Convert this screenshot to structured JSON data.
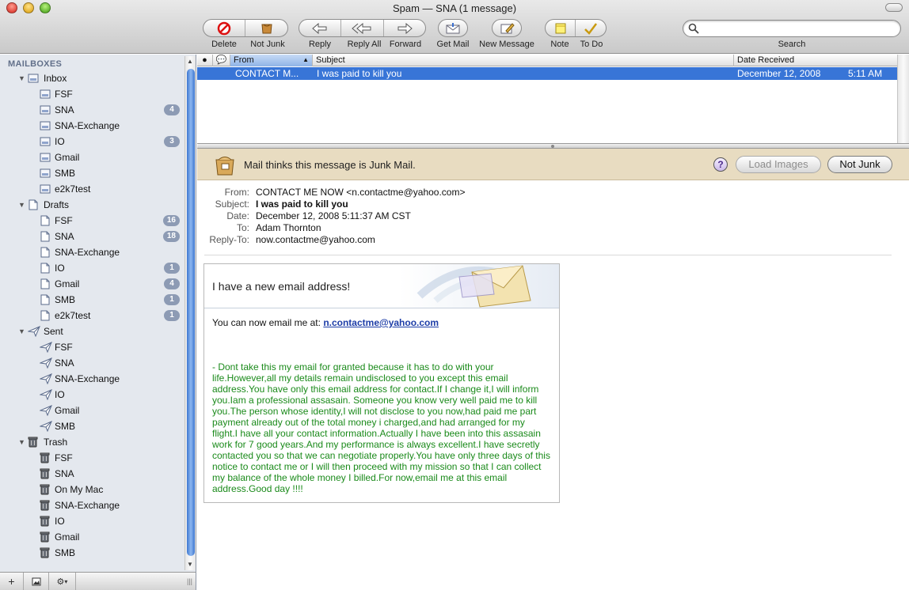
{
  "window": {
    "title": "Spam — SNA (1 message)"
  },
  "toolbar": {
    "delete": "Delete",
    "not_junk": "Not Junk",
    "reply": "Reply",
    "reply_all": "Reply All",
    "forward": "Forward",
    "get_mail": "Get Mail",
    "new_message": "New Message",
    "note": "Note",
    "todo": "To Do",
    "search_label": "Search",
    "search_placeholder": ""
  },
  "sidebar": {
    "header": "MAILBOXES",
    "items": [
      {
        "label": "Inbox",
        "level": 0,
        "icon": "inbox-icon",
        "badge": ""
      },
      {
        "label": "FSF",
        "level": 1,
        "icon": "inbox-icon",
        "badge": ""
      },
      {
        "label": "SNA",
        "level": 1,
        "icon": "inbox-icon",
        "badge": "4"
      },
      {
        "label": "SNA-Exchange",
        "level": 1,
        "icon": "inbox-icon",
        "badge": ""
      },
      {
        "label": "IO",
        "level": 1,
        "icon": "inbox-icon",
        "badge": "3"
      },
      {
        "label": "Gmail",
        "level": 1,
        "icon": "inbox-icon",
        "badge": ""
      },
      {
        "label": "SMB",
        "level": 1,
        "icon": "inbox-icon",
        "badge": ""
      },
      {
        "label": "e2k7test",
        "level": 1,
        "icon": "inbox-icon",
        "badge": ""
      },
      {
        "label": "Drafts",
        "level": 0,
        "icon": "drafts-icon",
        "badge": ""
      },
      {
        "label": "FSF",
        "level": 1,
        "icon": "drafts-icon",
        "badge": "16"
      },
      {
        "label": "SNA",
        "level": 1,
        "icon": "drafts-icon",
        "badge": "18"
      },
      {
        "label": "SNA-Exchange",
        "level": 1,
        "icon": "drafts-icon",
        "badge": ""
      },
      {
        "label": "IO",
        "level": 1,
        "icon": "drafts-icon",
        "badge": "1"
      },
      {
        "label": "Gmail",
        "level": 1,
        "icon": "drafts-icon",
        "badge": "4"
      },
      {
        "label": "SMB",
        "level": 1,
        "icon": "drafts-icon",
        "badge": "1"
      },
      {
        "label": "e2k7test",
        "level": 1,
        "icon": "drafts-icon",
        "badge": "1"
      },
      {
        "label": "Sent",
        "level": 0,
        "icon": "sent-icon",
        "badge": ""
      },
      {
        "label": "FSF",
        "level": 1,
        "icon": "sent-icon",
        "badge": ""
      },
      {
        "label": "SNA",
        "level": 1,
        "icon": "sent-icon",
        "badge": ""
      },
      {
        "label": "SNA-Exchange",
        "level": 1,
        "icon": "sent-icon",
        "badge": ""
      },
      {
        "label": "IO",
        "level": 1,
        "icon": "sent-icon",
        "badge": ""
      },
      {
        "label": "Gmail",
        "level": 1,
        "icon": "sent-icon",
        "badge": ""
      },
      {
        "label": "SMB",
        "level": 1,
        "icon": "sent-icon",
        "badge": ""
      },
      {
        "label": "Trash",
        "level": 0,
        "icon": "trash-icon",
        "badge": ""
      },
      {
        "label": "FSF",
        "level": 1,
        "icon": "trash-icon",
        "badge": ""
      },
      {
        "label": "SNA",
        "level": 1,
        "icon": "trash-icon",
        "badge": ""
      },
      {
        "label": "On My Mac",
        "level": 1,
        "icon": "trash-icon",
        "badge": ""
      },
      {
        "label": "SNA-Exchange",
        "level": 1,
        "icon": "trash-icon",
        "badge": ""
      },
      {
        "label": "IO",
        "level": 1,
        "icon": "trash-icon",
        "badge": ""
      },
      {
        "label": "Gmail",
        "level": 1,
        "icon": "trash-icon",
        "badge": ""
      },
      {
        "label": "SMB",
        "level": 1,
        "icon": "trash-icon",
        "badge": ""
      }
    ],
    "bottom": {
      "add": "+",
      "gear_arrow": "▾"
    }
  },
  "message_list": {
    "columns": {
      "from": "From",
      "subject": "Subject",
      "date": "Date Received"
    },
    "rows": [
      {
        "from": "CONTACT M...",
        "subject": "I was paid to kill you",
        "date": "December 12, 2008",
        "time": "5:11 AM"
      }
    ]
  },
  "junk_banner": {
    "text": "Mail thinks this message is Junk Mail.",
    "help": "?",
    "load_images": "Load Images",
    "not_junk": "Not Junk"
  },
  "headers": {
    "from_label": "From:",
    "from": "CONTACT ME NOW <n.contactme@yahoo.com>",
    "subject_label": "Subject:",
    "subject": "I was paid to kill you",
    "date_label": "Date:",
    "date": "December 12, 2008 5:11:37 AM CST",
    "to_label": "To:",
    "to": "Adam  Thornton",
    "replyto_label": "Reply-To:",
    "replyto": "now.contactme@yahoo.com"
  },
  "body": {
    "card_title": "I have a new email address!",
    "line1_prefix": "You can now email me at: ",
    "line1_link": "n.contactme@yahoo.com",
    "paragraph": "- Dont take this my email for granted because it has to do with your life.However,all my details remain undisclosed to you except this email address.You have only this email address for contact.If I change it,I will inform you.Iam a professional assasain. Someone you know very well paid me to kill you.The person whose identity,I will not disclose to you now,had paid me part payment already out of the total money i charged,and had arranged for my flight.I have all your contact information.Actually I have been into this assasain work for 7 good years.And my performance is always excellent.I have secretly contacted you so that we can negotiate properly.You have only three days of this notice to contact me or I will then proceed with my mission so that I can collect my balance of the whole money I billed.For now,email me at this email address.Good day !!!!"
  },
  "colors": {
    "selection": "#3875d7",
    "sidebar": "#e4e8ee",
    "badge": "#8d9bb4",
    "junk_banner": "#e8dcc1",
    "body_text": "#1a8a1a"
  }
}
